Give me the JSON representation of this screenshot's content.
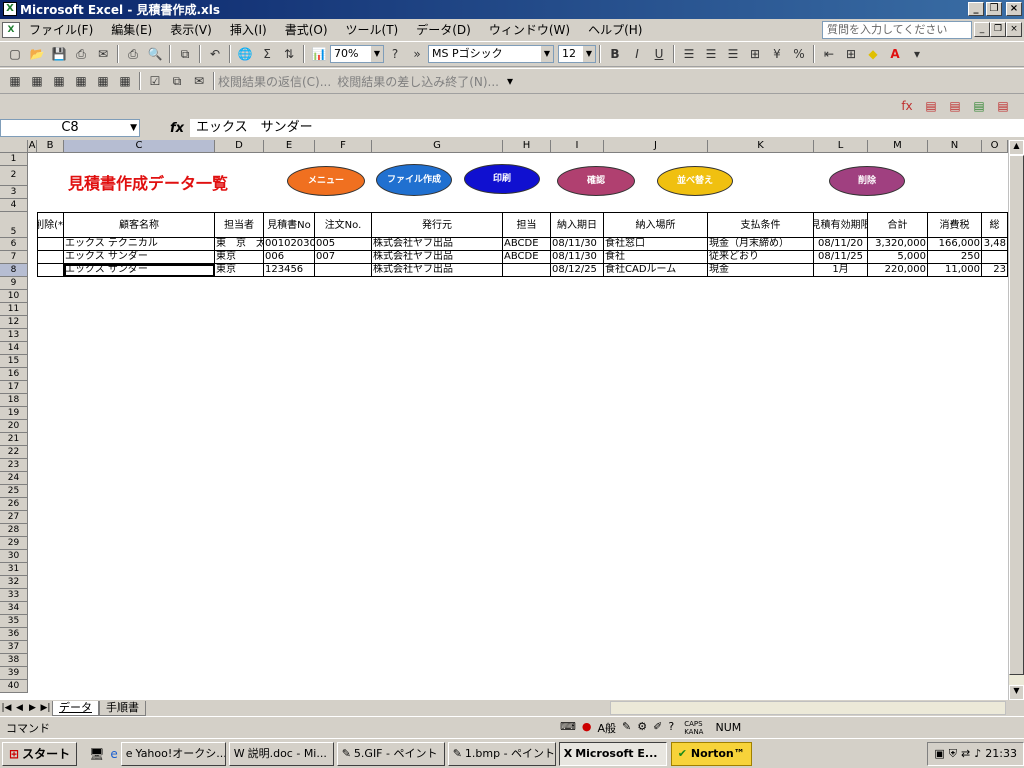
{
  "window": {
    "title": "Microsoft Excel - 見積書作成.xls"
  },
  "menu": {
    "items": [
      "ファイル(F)",
      "編集(E)",
      "表示(V)",
      "挿入(I)",
      "書式(O)",
      "ツール(T)",
      "データ(D)",
      "ウィンドウ(W)",
      "ヘルプ(H)"
    ],
    "help_placeholder": "質問を入力してください"
  },
  "toolbar": {
    "zoom": "70%",
    "font": "MS Pゴシック",
    "font_size": "12",
    "review_reply": "校閲結果の返信(C)...",
    "review_end": "校閲結果の差し込み終了(N)..."
  },
  "formula_bar": {
    "name_box": "C8",
    "fx": "fx",
    "content": "エックス　サンダー"
  },
  "columns": [
    "A",
    "B",
    "C",
    "D",
    "E",
    "F",
    "G",
    "H",
    "I",
    "J",
    "K",
    "L",
    "M",
    "N",
    "O"
  ],
  "rows": [
    "1",
    "2",
    "3",
    "4",
    "5",
    "6",
    "7",
    "8",
    "9",
    "10",
    "11",
    "12",
    "13",
    "14",
    "15",
    "16",
    "17",
    "18",
    "19",
    "20",
    "21",
    "22",
    "23",
    "24",
    "25",
    "26",
    "27",
    "28",
    "29",
    "30",
    "31",
    "32",
    "33",
    "34",
    "35",
    "36",
    "37",
    "38",
    "39",
    "40"
  ],
  "sheet": {
    "title": "見積書作成データ一覧",
    "buttons": {
      "menu": "メニュー",
      "file": "ファイル作成",
      "print": "印刷",
      "confirm": "確認",
      "sort": "並べ替え",
      "delete": "削除"
    },
    "headers": [
      "削除(*)",
      "顧客名称",
      "担当者",
      "見積書No",
      "注文No.",
      "発行元",
      "担当",
      "納入期日",
      "納入場所",
      "支払条件",
      "見積有効期限",
      "合計",
      "消費税",
      "総"
    ],
    "records": [
      [
        "",
        "エックス テクニカル",
        "東　京　太",
        "00102030",
        "005",
        "株式会社ヤフ出品",
        "ABCDE",
        "08/11/30",
        "食社窓口",
        "現金（月末締め）",
        "08/11/20",
        "3,320,000",
        "166,000",
        "3,48"
      ],
      [
        "",
        "エックス サンダー",
        "東京",
        "006",
        "007",
        "株式会社ヤフ出品",
        "ABCDE",
        "08/11/30",
        "食社",
        "従来どおり",
        "08/11/25",
        "5,000",
        "250",
        ""
      ],
      [
        "",
        "エックス サンダー",
        "東京",
        "123456",
        "",
        "株式会社ヤフ出品",
        "",
        "08/12/25",
        "食社CADルーム",
        "現金",
        "1月",
        "220,000",
        "11,000",
        "23"
      ]
    ]
  },
  "tabs": [
    "データ",
    "手順書"
  ],
  "status": {
    "mode": "コマンド",
    "caps": "CAPS",
    "kana": "KANA",
    "num": "NUM"
  },
  "taskbar": {
    "start": "スタート",
    "tasks": [
      "Yahoo!オークシ...",
      "説明.doc - Mi...",
      "5.GIF - ペイント",
      "1.bmp - ペイント",
      "Microsoft E..."
    ],
    "norton": "Norton™",
    "clock": "21:33"
  },
  "colors": {
    "title_red": "#e01010",
    "btn_menu": "#f07020",
    "btn_file": "#2070d0",
    "btn_print": "#1010d0",
    "btn_confirm": "#b04070",
    "btn_sort": "#f0c010",
    "btn_delete": "#a04080"
  }
}
